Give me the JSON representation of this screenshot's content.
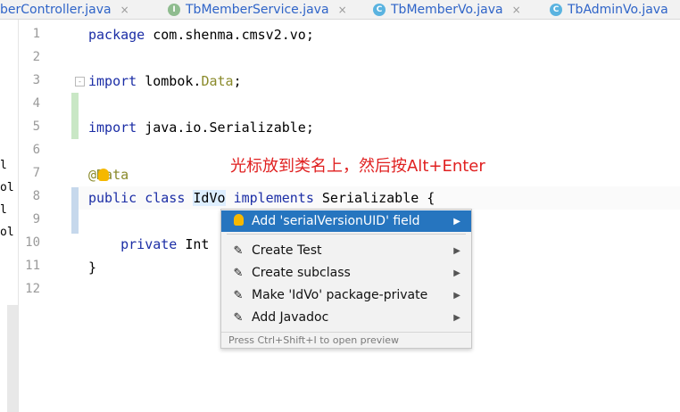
{
  "tabs": [
    {
      "label": "berController.java",
      "icon": "none"
    },
    {
      "label": "TbMemberService.java",
      "icon": "interface-icon",
      "badge": "I"
    },
    {
      "label": "TbMemberVo.java",
      "icon": "class-icon",
      "badge": "C"
    },
    {
      "label": "TbAdminVo.java",
      "icon": "class-icon",
      "badge": "C"
    }
  ],
  "tab_close_glyph": "×",
  "left_strip_fragments": [
    "l",
    "ol",
    "l",
    "ol"
  ],
  "line_numbers": [
    "1",
    "2",
    "3",
    "4",
    "5",
    "6",
    "7",
    "8",
    "9",
    "10",
    "11",
    "12"
  ],
  "code": {
    "l1_kw": "package",
    "l1_rest": " com.shenma.cmsv2.vo;",
    "l3_kw": "import",
    "l3_rest": " lombok.",
    "l3_ann": "Data",
    "l3_end": ";",
    "l5_kw": "import",
    "l5_rest": " java.io.Serializable;",
    "l7_at": "@",
    "l7_ann": "Data",
    "l8_kw1": "public",
    "l8_kw2": "class",
    "l8_name": "IdVo",
    "l8_kw3": "implements",
    "l8_rest": " Serializable {",
    "l10_kw": "private",
    "l10_rest": " Int",
    "l11": "}"
  },
  "annotation_note": "光标放到类名上，然后按Alt+Enter",
  "popup": {
    "items": [
      {
        "label": "Add 'serialVersionUID' field",
        "icon": "lightbulb-icon"
      },
      {
        "label": "Create Test",
        "icon": "pencil-icon"
      },
      {
        "label": "Create subclass",
        "icon": "pencil-icon"
      },
      {
        "label": "Make 'IdVo' package-private",
        "icon": "pencil-icon"
      },
      {
        "label": "Add Javadoc",
        "icon": "pencil-icon"
      }
    ],
    "arrow_glyph": "▶",
    "footer": "Press Ctrl+Shift+I to open preview"
  },
  "colors": {
    "keyword": "#1c2ea6",
    "annotation": "#8a8a2a",
    "note": "#e02020",
    "popup_active": "#2675bf",
    "bulb": "#f5b800"
  }
}
